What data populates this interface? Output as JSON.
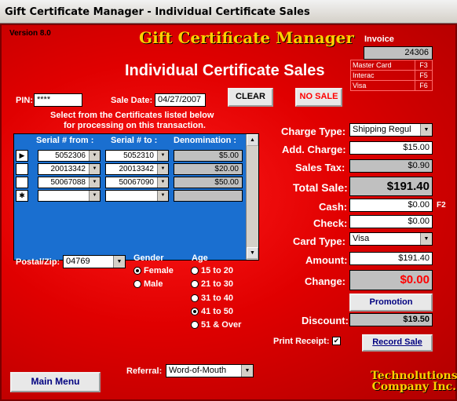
{
  "window": {
    "title": "Gift Certificate Manager - Individual Certificate Sales"
  },
  "header": {
    "version": "Version 8.0",
    "app_title": "Gift Certificate Manager",
    "subtitle": "Individual Certificate Sales"
  },
  "invoice": {
    "label": "Invoice",
    "number": "24306",
    "payment_keys": [
      {
        "name": "Master Card",
        "key": "F3"
      },
      {
        "name": "Interac",
        "key": "F5"
      },
      {
        "name": "Visa",
        "key": "F6"
      }
    ]
  },
  "pin": {
    "label": "PIN:",
    "value": "****"
  },
  "sale_date": {
    "label": "Sale Date:",
    "value": "04/27/2007"
  },
  "buttons": {
    "clear": "CLEAR",
    "no_sale": "NO SALE",
    "promotion": "Promotion",
    "record_sale": "Record Sale",
    "main_menu": "Main Menu"
  },
  "instructions": {
    "line1": "Select from the Certificates listed below",
    "line2": "for processing on this transaction."
  },
  "certificates": {
    "headers": {
      "serial_from": "Serial # from :",
      "serial_to": "Serial # to :",
      "denomination": "Denomination :"
    },
    "rows": [
      {
        "from": "5052306",
        "to": "5052310",
        "denomination": "$5.00"
      },
      {
        "from": "20013342",
        "to": "20013342",
        "denomination": "$20.00"
      },
      {
        "from": "50067088",
        "to": "50067090",
        "denomination": "$50.00"
      }
    ]
  },
  "charges": {
    "charge_type": {
      "label": "Charge Type:",
      "value": "Shipping Regul"
    },
    "add_charge": {
      "label": "Add. Charge:",
      "value": "$15.00"
    },
    "sales_tax": {
      "label": "Sales Tax:",
      "value": "$0.90"
    },
    "total_sale": {
      "label": "Total Sale:",
      "value": "$191.40"
    },
    "cash": {
      "label": "Cash:",
      "value": "$0.00",
      "key": "F2"
    },
    "check": {
      "label": "Check:",
      "value": "$0.00"
    },
    "card_type": {
      "label": "Card Type:",
      "value": "Visa"
    },
    "amount": {
      "label": "Amount:",
      "value": "$191.40"
    },
    "change": {
      "label": "Change:",
      "value": "$0.00"
    },
    "discount": {
      "label": "Discount:",
      "value": "$19.50"
    },
    "print_receipt": {
      "label": "Print Receipt:",
      "checked": true,
      "mark": "✔"
    }
  },
  "postal": {
    "label": "Postal/Zip:",
    "value": "04769"
  },
  "gender": {
    "label": "Gender",
    "options": [
      "Female",
      "Male"
    ],
    "selected": "Female"
  },
  "age": {
    "label": "Age",
    "options": [
      "15 to 20",
      "21 to 30",
      "31 to 40",
      "41 to 50",
      "51 & Over"
    ],
    "selected": "41 to 50"
  },
  "referral": {
    "label": "Referral:",
    "value": "Word-of-Mouth"
  },
  "company": {
    "line1": "Technolutions",
    "line2": "Company Inc."
  },
  "colors": {
    "form_bg": "#e00000",
    "accent_gold": "#ffd000",
    "grid_blue": "#1a6fd0",
    "change_red": "#ff0000"
  }
}
